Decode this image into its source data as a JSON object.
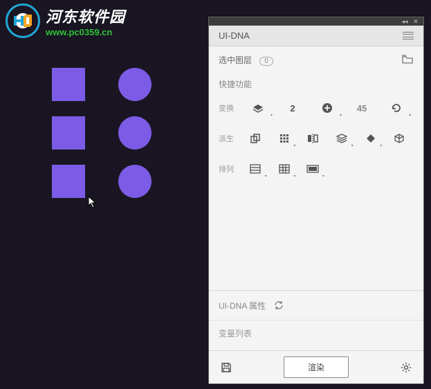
{
  "watermark": {
    "title": "河东软件园",
    "url": "www.pc0359.cn"
  },
  "panel": {
    "tab_title": "UI-DNA",
    "selected_layer_label": "选中图层",
    "selected_layer_count": "0",
    "quick_functions_label": "快捷功能",
    "rows": {
      "transform": {
        "label": "变换",
        "value1": "2",
        "value2": "45"
      },
      "derive": {
        "label": "派生"
      },
      "arrange": {
        "label": "排列"
      }
    },
    "properties_label": "UI-DNA 属性",
    "variable_list_label": "变量列表",
    "footer": {
      "render": "渲染"
    }
  }
}
